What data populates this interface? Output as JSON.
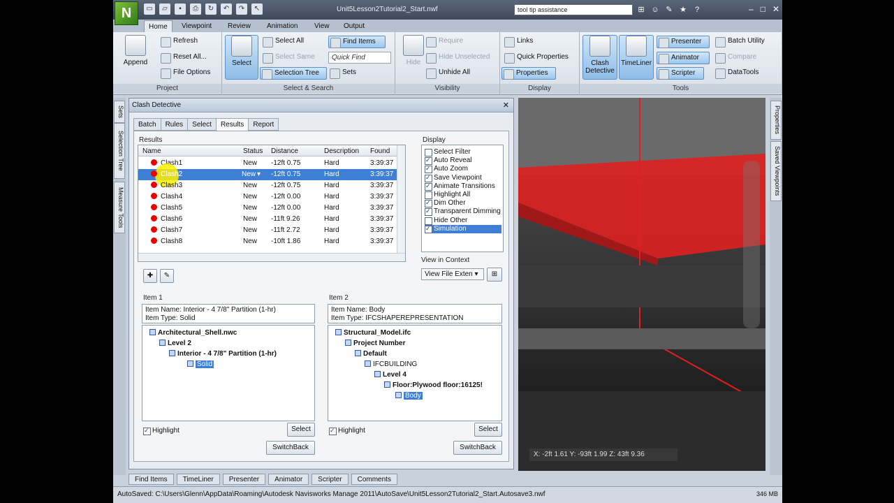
{
  "window": {
    "title": "Unit5Lesson2Tutorial2_Start.nwf",
    "search_value": "tool tip assistance",
    "logo_letter": "N"
  },
  "tabs": [
    "Home",
    "Viewpoint",
    "Review",
    "Animation",
    "View",
    "Output"
  ],
  "ribbon": {
    "project": {
      "label": "Project",
      "append": "Append",
      "refresh": "Refresh",
      "reset_all": "Reset All...",
      "file_options": "File Options"
    },
    "select_search": {
      "label": "Select & Search",
      "select": "Select",
      "select_all": "Select All",
      "select_same": "Select Same",
      "selection_tree": "Selection Tree",
      "find_items": "Find Items",
      "quick_find": "Quick Find",
      "sets": "Sets"
    },
    "visibility": {
      "label": "Visibility",
      "hide": "Hide",
      "require": "Require",
      "hide_unselected": "Hide Unselected",
      "unhide_all": "Unhide All"
    },
    "display": {
      "label": "Display",
      "links": "Links",
      "quick_properties": "Quick Properties",
      "properties": "Properties"
    },
    "tools": {
      "label": "Tools",
      "clash_detective": "Clash Detective",
      "timeliner": "TimeLiner",
      "presenter": "Presenter",
      "animator": "Animator",
      "scripter": "Scripter",
      "batch_utility": "Batch Utility",
      "compare": "Compare",
      "datatools": "DataTools"
    }
  },
  "left_dock": [
    "Sets",
    "Selection Tree",
    "Measure Tools"
  ],
  "right_dock": [
    "Properties",
    "Saved Viewpoints"
  ],
  "clash_panel": {
    "title": "Clash Detective",
    "tabs": [
      "Batch",
      "Rules",
      "Select",
      "Results",
      "Report"
    ],
    "results_label": "Results",
    "columns": [
      "Name",
      "Status",
      "Distance",
      "Description",
      "Found"
    ],
    "rows": [
      {
        "name": "Clash1",
        "status": "New",
        "distance": "-12ft 0.75",
        "description": "Hard",
        "found": "3:39:37"
      },
      {
        "name": "Clash2",
        "status": "New",
        "distance": "-12ft 0.75",
        "description": "Hard",
        "found": "3:39:37"
      },
      {
        "name": "Clash3",
        "status": "New",
        "distance": "-12ft 0.75",
        "description": "Hard",
        "found": "3:39:37"
      },
      {
        "name": "Clash4",
        "status": "New",
        "distance": "-12ft 0.00",
        "description": "Hard",
        "found": "3:39:37"
      },
      {
        "name": "Clash5",
        "status": "New",
        "distance": "-12ft 0.00",
        "description": "Hard",
        "found": "3:39:37"
      },
      {
        "name": "Clash6",
        "status": "New",
        "distance": "-11ft 9.26",
        "description": "Hard",
        "found": "3:39:37"
      },
      {
        "name": "Clash7",
        "status": "New",
        "distance": "-11ft 2.72",
        "description": "Hard",
        "found": "3:39:37"
      },
      {
        "name": "Clash8",
        "status": "New",
        "distance": "-10ft 1.86",
        "description": "Hard",
        "found": "3:39:37"
      }
    ],
    "display_label": "Display",
    "display_options": [
      {
        "label": "Select Filter",
        "checked": false
      },
      {
        "label": "Auto Reveal",
        "checked": true
      },
      {
        "label": "Auto Zoom",
        "checked": true
      },
      {
        "label": "Save Viewpoint",
        "checked": true
      },
      {
        "label": "Animate Transitions",
        "checked": true
      },
      {
        "label": "Highlight All",
        "checked": false
      },
      {
        "label": "Dim Other",
        "checked": true
      },
      {
        "label": "Transparent Dimming",
        "checked": true
      },
      {
        "label": "Hide Other",
        "checked": false
      },
      {
        "label": "Simulation",
        "checked": true
      }
    ],
    "view_in_context_label": "View in Context",
    "view_in_context_value": "View File Exten",
    "item1": {
      "label": "Item 1",
      "item_name": "Item Name: Interior - 4 7/8\" Partition (1-hr)",
      "item_type": "Item Type: Solid",
      "tree": [
        "Architectural_Shell.nwc",
        "Level 2",
        "Interior - 4 7/8\" Partition (1-hr)",
        "Solid"
      ],
      "highlight": "Highlight",
      "select": "Select",
      "switchback": "SwitchBack"
    },
    "item2": {
      "label": "Item 2",
      "item_name": "Item Name: Body",
      "item_type": "Item Type: IFCSHAPEREPRESENTATION",
      "tree": [
        "Structural_Model.ifc",
        "Project Number",
        "Default",
        "IFCBUILDING",
        "Level 4",
        "Floor:Plywood floor:16125!",
        "Body"
      ],
      "highlight": "Highlight",
      "select": "Select",
      "switchback": "SwitchBack"
    }
  },
  "viewport": {
    "coords": "X: -2ft 1.61  Y: -93ft 1.99  Z: 43ft 9.36"
  },
  "bottom_tabs": [
    "Find Items",
    "TimeLiner",
    "Presenter",
    "Animator",
    "Scripter",
    "Comments"
  ],
  "status": {
    "text": "AutoSaved: C:\\Users\\Glenn\\AppData\\Roaming\\Autodesk Navisworks Manage 2011\\AutoSave\\Unit5Lesson2Tutorial2_Start.Autosave3.nwf",
    "memory": "346 MB"
  },
  "colors": {
    "clash_red": "#e00000",
    "selection_blue": "#3d7fd5",
    "highlight_yellow": "#fff000"
  }
}
